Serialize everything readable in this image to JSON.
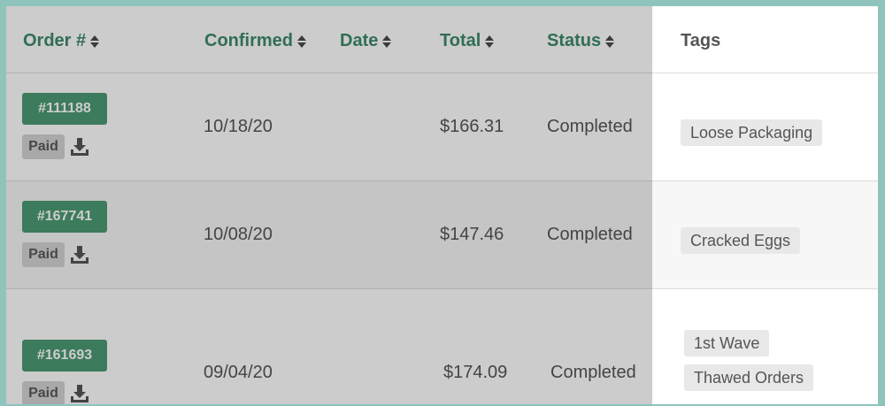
{
  "table": {
    "headers": {
      "order": "Order #",
      "confirmed": "Confirmed",
      "date": "Date",
      "total": "Total",
      "status": "Status",
      "tags": "Tags"
    },
    "rows": [
      {
        "order_number": "#111188",
        "payment": "Paid",
        "confirmed": "10/18/20",
        "total": "$166.31",
        "status": "Completed",
        "tags": [
          "Loose Packaging"
        ]
      },
      {
        "order_number": "#167741",
        "payment": "Paid",
        "confirmed": "10/08/20",
        "total": "$147.46",
        "status": "Completed",
        "tags": [
          "Cracked Eggs"
        ]
      },
      {
        "order_number": "#161693",
        "payment": "Paid",
        "confirmed": "09/04/20",
        "total": "$174.09",
        "status": "Completed",
        "tags": [
          "1st Wave",
          "Thawed Orders"
        ]
      }
    ]
  },
  "colors": {
    "accent_green": "#3e8a6a",
    "order_badge": "#4b9a74",
    "frame": "#8fc4bd"
  },
  "icons": {
    "sort": "sort-icon",
    "download": "download-icon"
  }
}
